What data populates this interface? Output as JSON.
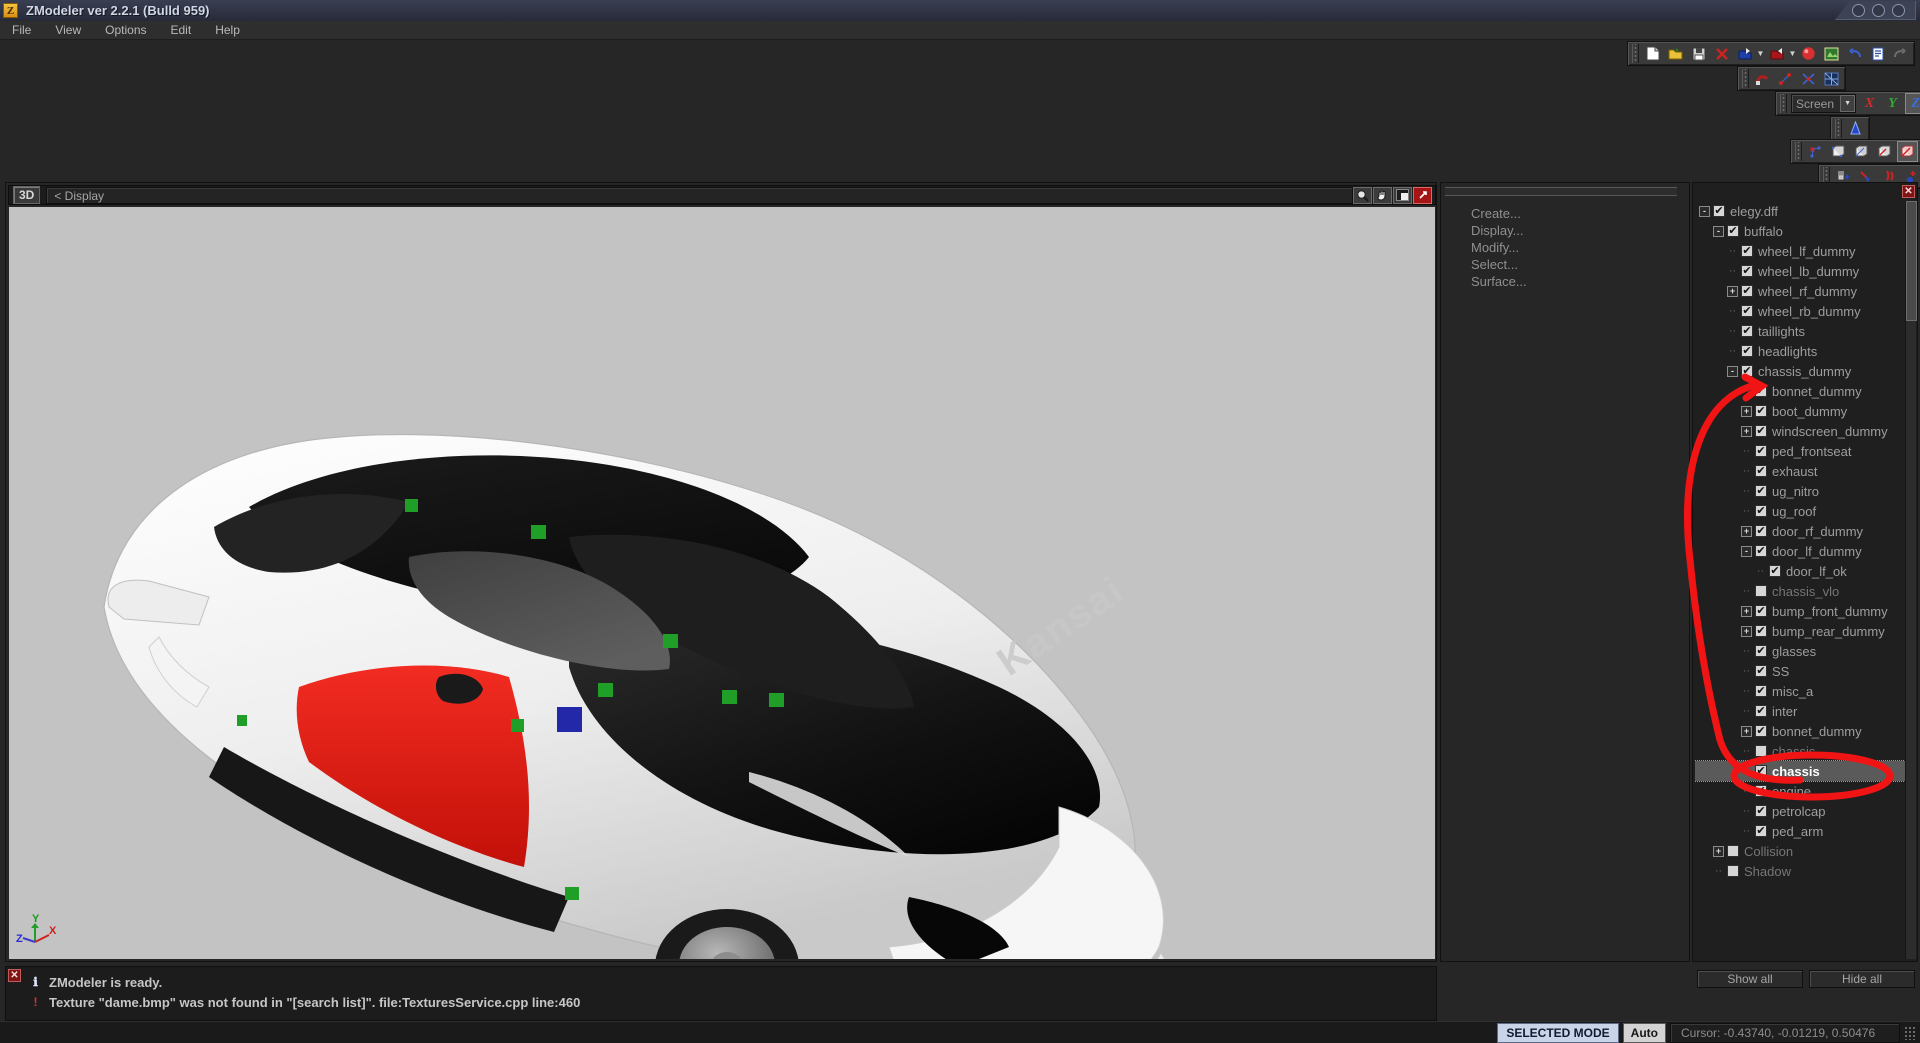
{
  "window": {
    "title": "ZModeler ver 2.2.1 (Bulld 959)",
    "app_icon": "Z",
    "controls": [
      "minimize-button",
      "maximize-button",
      "close-button"
    ]
  },
  "menubar": {
    "items": [
      {
        "label": "File"
      },
      {
        "label": "View"
      },
      {
        "label": "Options"
      },
      {
        "label": "Edit"
      },
      {
        "label": "Help"
      }
    ]
  },
  "toolbars": {
    "file": {
      "buttons": [
        {
          "name": "new-file-icon",
          "glyph": "⬜"
        },
        {
          "name": "open-file-icon",
          "glyph": "📂"
        },
        {
          "name": "save-file-icon",
          "glyph": "💾"
        },
        {
          "name": "delete-icon",
          "glyph": "✕"
        },
        {
          "name": "import-icon",
          "glyph": "⬇"
        },
        {
          "name": "export-icon",
          "glyph": "⬆"
        },
        {
          "name": "render-sphere-icon",
          "glyph": "●"
        },
        {
          "name": "materials-icon",
          "glyph": "▦"
        },
        {
          "name": "undo-icon",
          "glyph": "↶"
        },
        {
          "name": "properties-icon",
          "glyph": "≣"
        },
        {
          "name": "redo-icon",
          "glyph": "↷"
        }
      ]
    },
    "geometry": {
      "buttons": [
        {
          "name": "magnet-snap-icon",
          "glyph": "✦"
        },
        {
          "name": "vertex-mode-icon",
          "glyph": "✶"
        },
        {
          "name": "edge-mode-icon",
          "glyph": "✕"
        },
        {
          "name": "mesh-mode-icon",
          "glyph": "⌗"
        }
      ]
    },
    "coordsys": {
      "selected": "Screen",
      "dropdown_icon": "chevron-down-icon",
      "axes": [
        {
          "label": "X",
          "color": "#d22b2b"
        },
        {
          "label": "Y",
          "color": "#2fae2f"
        },
        {
          "label": "Z",
          "color": "#3b6fe0"
        }
      ]
    },
    "cone": {
      "buttons": [
        {
          "name": "cone-primitive-icon",
          "glyph": "▲"
        }
      ]
    },
    "selection": {
      "buttons": [
        {
          "name": "vertex-select-icon",
          "glyph": "∷"
        },
        {
          "name": "face-select-icon",
          "glyph": "⬜"
        },
        {
          "name": "polygon-select-icon",
          "glyph": "⬛"
        },
        {
          "name": "object-select-icon",
          "glyph": "▣"
        },
        {
          "name": "element-select-icon",
          "glyph": "◧"
        }
      ]
    },
    "tools": {
      "buttons": [
        {
          "name": "paint-tool-icon",
          "glyph": "⚒"
        },
        {
          "name": "uv-mapper-icon",
          "glyph": "◢"
        },
        {
          "name": "material-tool-icon",
          "glyph": "❦"
        },
        {
          "name": "add-tool-icon",
          "glyph": "✣"
        },
        {
          "name": "tools-overflow-icon",
          "glyph": "▾"
        }
      ]
    }
  },
  "viewport": {
    "mode_button": "3D",
    "label": "< Display",
    "controls": [
      {
        "name": "zoom-tool-icon",
        "glyph": "🔍"
      },
      {
        "name": "pan-tool-icon",
        "glyph": "✋"
      },
      {
        "name": "shading-mode-icon",
        "glyph": "◨"
      },
      {
        "name": "maximize-viewport-icon",
        "glyph": "↗"
      }
    ],
    "background_color": "#c3c3c3",
    "axis_gizmo": {
      "x": "X",
      "y": "Y",
      "z": "Z"
    },
    "model": {
      "decal_text": "Kansai",
      "body_color": "#f2f2f2",
      "door_color": "#e8201c",
      "roof_color": "#141414",
      "glass_color": "#4a4a4a",
      "dummy_marker_color": "#1f9f28",
      "selected_marker_color": "#2328a8"
    }
  },
  "command_panel": {
    "close_icon": "✕",
    "items": [
      {
        "label": "Create..."
      },
      {
        "label": "Display..."
      },
      {
        "label": "Modify..."
      },
      {
        "label": "Select..."
      },
      {
        "label": "Surface..."
      }
    ]
  },
  "tree_panel": {
    "close_icon": "✕",
    "buttons": {
      "show_all": "Show all",
      "hide_all": "Hide all"
    },
    "nodes": [
      {
        "label": "elegy.dff",
        "indent": 0,
        "expander": "-",
        "checked": true,
        "selected": false
      },
      {
        "label": "buffalo",
        "indent": 1,
        "expander": "-",
        "checked": true,
        "selected": false
      },
      {
        "label": "wheel_lf_dummy",
        "indent": 2,
        "expander": "",
        "checked": true,
        "selected": false
      },
      {
        "label": "wheel_lb_dummy",
        "indent": 2,
        "expander": "",
        "checked": true,
        "selected": false
      },
      {
        "label": "wheel_rf_dummy",
        "indent": 2,
        "expander": "+",
        "checked": true,
        "selected": false
      },
      {
        "label": "wheel_rb_dummy",
        "indent": 2,
        "expander": "",
        "checked": true,
        "selected": false
      },
      {
        "label": "taillights",
        "indent": 2,
        "expander": "",
        "checked": true,
        "selected": false
      },
      {
        "label": "headlights",
        "indent": 2,
        "expander": "",
        "checked": true,
        "selected": false
      },
      {
        "label": "chassis_dummy",
        "indent": 2,
        "expander": "-",
        "checked": true,
        "selected": false
      },
      {
        "label": "bonnet_dummy",
        "indent": 3,
        "expander": "",
        "checked": true,
        "selected": false
      },
      {
        "label": "boot_dummy",
        "indent": 3,
        "expander": "+",
        "checked": true,
        "selected": false
      },
      {
        "label": "windscreen_dummy",
        "indent": 3,
        "expander": "+",
        "checked": true,
        "selected": false
      },
      {
        "label": "ped_frontseat",
        "indent": 3,
        "expander": "",
        "checked": true,
        "selected": false
      },
      {
        "label": "exhaust",
        "indent": 3,
        "expander": "",
        "checked": true,
        "selected": false
      },
      {
        "label": "ug_nitro",
        "indent": 3,
        "expander": "",
        "checked": true,
        "selected": false
      },
      {
        "label": "ug_roof",
        "indent": 3,
        "expander": "",
        "checked": true,
        "selected": false
      },
      {
        "label": "door_rf_dummy",
        "indent": 3,
        "expander": "+",
        "checked": true,
        "selected": false
      },
      {
        "label": "door_lf_dummy",
        "indent": 3,
        "expander": "-",
        "checked": true,
        "selected": false
      },
      {
        "label": "door_lf_ok",
        "indent": 4,
        "expander": "",
        "checked": true,
        "selected": false
      },
      {
        "label": "chassis_vlo",
        "indent": 3,
        "expander": "",
        "checked": false,
        "selected": false
      },
      {
        "label": "bump_front_dummy",
        "indent": 3,
        "expander": "+",
        "checked": true,
        "selected": false
      },
      {
        "label": "bump_rear_dummy",
        "indent": 3,
        "expander": "+",
        "checked": true,
        "selected": false
      },
      {
        "label": "glasses",
        "indent": 3,
        "expander": "",
        "checked": true,
        "selected": false
      },
      {
        "label": "SS",
        "indent": 3,
        "expander": "",
        "checked": true,
        "selected": false
      },
      {
        "label": "misc_a",
        "indent": 3,
        "expander": "",
        "checked": true,
        "selected": false
      },
      {
        "label": "inter",
        "indent": 3,
        "expander": "",
        "checked": true,
        "selected": false
      },
      {
        "label": "bonnet_dummy",
        "indent": 3,
        "expander": "+",
        "checked": true,
        "selected": false
      },
      {
        "label": "chassis",
        "indent": 3,
        "expander": "",
        "checked": false,
        "selected": false
      },
      {
        "label": "chassis",
        "indent": 3,
        "expander": "",
        "checked": true,
        "selected": true
      },
      {
        "label": "engine",
        "indent": 3,
        "expander": "",
        "checked": true,
        "selected": false
      },
      {
        "label": "petrolcap",
        "indent": 3,
        "expander": "",
        "checked": true,
        "selected": false
      },
      {
        "label": "ped_arm",
        "indent": 3,
        "expander": "",
        "checked": true,
        "selected": false
      },
      {
        "label": "Collision",
        "indent": 1,
        "expander": "+",
        "checked": false,
        "selected": false
      },
      {
        "label": "Shadow",
        "indent": 1,
        "expander": "",
        "checked": false,
        "selected": false
      }
    ]
  },
  "log_panel": {
    "close_icon": "✕",
    "messages": [
      {
        "icon": "info-icon",
        "glyph": "ℹ",
        "text": "ZModeler is ready."
      },
      {
        "icon": "error-icon",
        "glyph": "!",
        "text": "Texture \"dame.bmp\" was not found in \"[search list]\". file:TexturesService.cpp line:460"
      }
    ]
  },
  "statusbar": {
    "mode": "SELECTED MODE",
    "auto": "Auto",
    "cursor": "Cursor: -0.43740, -0.01219, 0.50476"
  },
  "annotation": {
    "color": "#f01414",
    "description": "red-hand-drawn-arrow-and-ellipse-highlighting-chassis-node"
  }
}
